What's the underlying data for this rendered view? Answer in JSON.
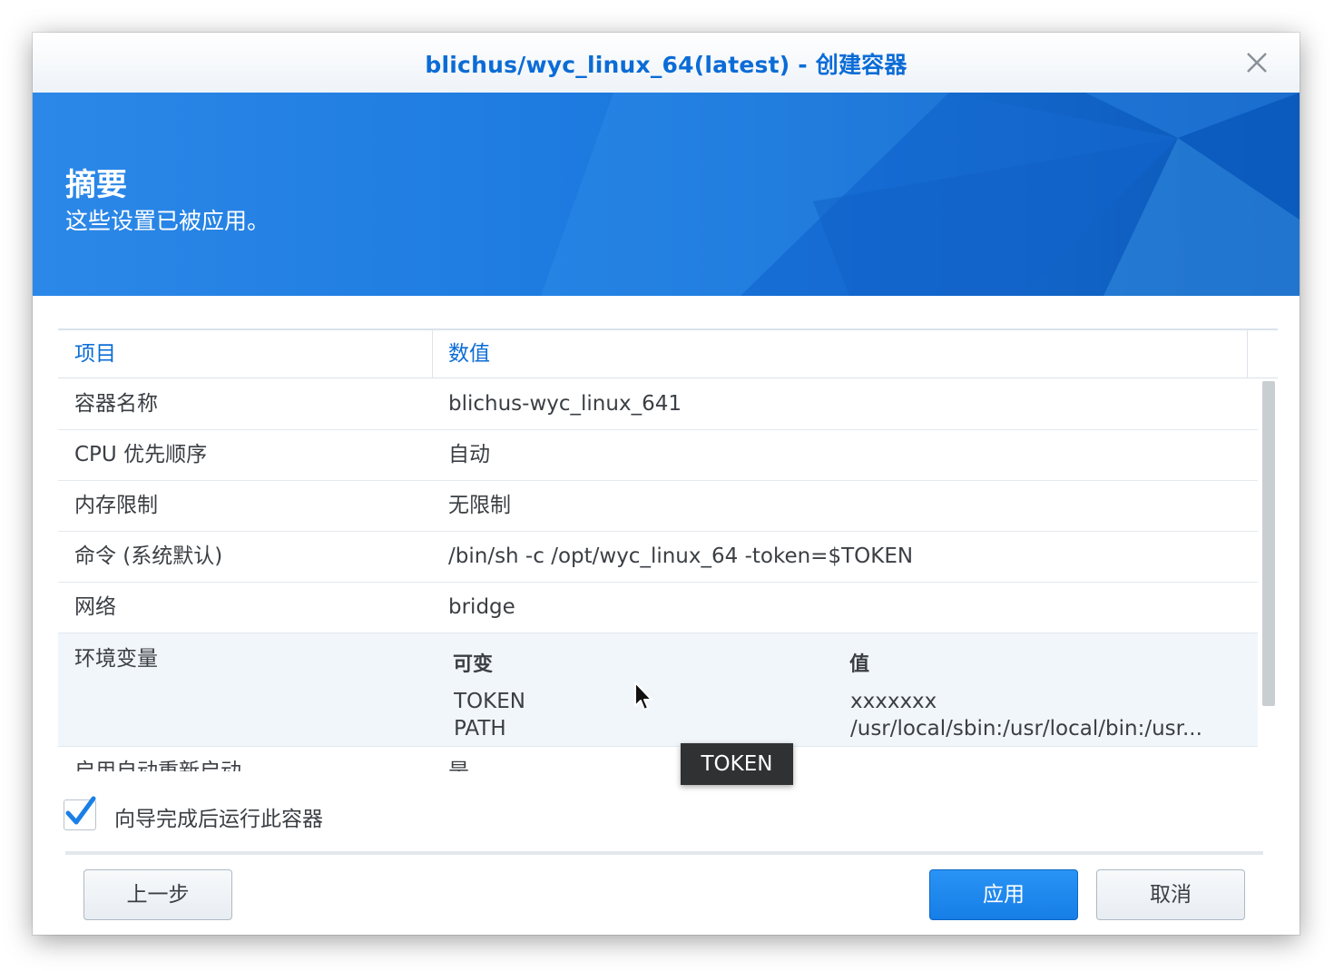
{
  "window": {
    "title": "blichus/wyc_linux_64(latest) - 创建容器"
  },
  "banner": {
    "title": "摘要",
    "subtitle": "这些设置已被应用。"
  },
  "table": {
    "columns": [
      "项目",
      "数值"
    ],
    "rows": [
      {
        "key": "容器名称",
        "value": "blichus-wyc_linux_641"
      },
      {
        "key": "CPU 优先顺序",
        "value": "自动"
      },
      {
        "key": "内存限制",
        "value": "无限制"
      },
      {
        "key": "命令 (系统默认)",
        "value": "/bin/sh -c /opt/wyc_linux_64 -token=$TOKEN"
      },
      {
        "key": "网络",
        "value": "bridge"
      }
    ],
    "env": {
      "key": "环境变量",
      "headers": [
        "可变",
        "值"
      ],
      "vars": [
        {
          "name": "TOKEN",
          "value": "xxxxxxx"
        },
        {
          "name": "PATH",
          "value": "/usr/local/sbin:/usr/local/bin:/usr..."
        }
      ]
    },
    "partial_row": {
      "key": "启用自动重新启动",
      "value": "是"
    }
  },
  "tooltip": {
    "text": "TOKEN"
  },
  "run_after": {
    "label": "向导完成后运行此容器",
    "checked": true
  },
  "buttons": {
    "back": "上一步",
    "apply": "应用",
    "cancel": "取消"
  },
  "colors": {
    "accent": "#0b6cd6",
    "banner": "#1f7fe2",
    "primary_button": "#1a85ee"
  },
  "icons": {
    "close": "close-icon",
    "check": "checkmark-icon",
    "cursor": "mouse-pointer-icon"
  }
}
